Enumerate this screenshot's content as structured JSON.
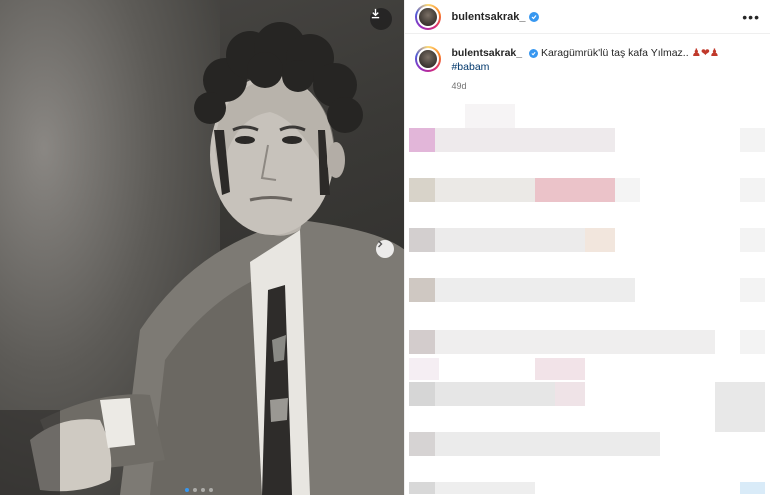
{
  "post": {
    "username": "bulentsakrak_",
    "caption_text": "Karagümrük'lü taş kafa Yılmaz.. ",
    "caption_emojis": "♟❤♟",
    "hashtag": "#babam",
    "time_ago": "49d",
    "more_label": "•••"
  },
  "media": {
    "carousel_count": 4,
    "active_index": 0
  },
  "colors": {
    "accent": "#3797f0",
    "hashtag": "#00376b",
    "verified": "#3797f0",
    "heart": "#ed4956"
  },
  "icons": {
    "download": "download-icon",
    "next": "chevron-right-icon",
    "more": "more-options-icon",
    "verified": "verified-badge-icon"
  }
}
